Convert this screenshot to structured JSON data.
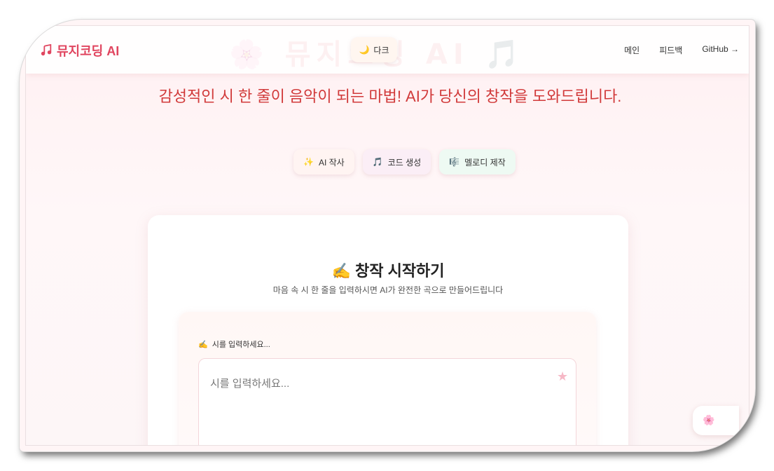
{
  "brand": {
    "name": "뮤지코딩 AI",
    "logo_icon": "music-notes-icon"
  },
  "theme_toggle": {
    "icon": "crescent-moon-icon",
    "label": "다크"
  },
  "nav": {
    "links": [
      "메인",
      "피드백",
      "GitHub →"
    ]
  },
  "hero": {
    "background_title": "🌸 뮤지코딩 AI 🎵",
    "headline": "감성적인 시 한 줄이 음악이 되는 마법! AI가 당신의 창작을 도와드립니다."
  },
  "features": [
    {
      "icon": "✨",
      "label": "AI 작사"
    },
    {
      "icon": "🎵",
      "label": "코드 생성"
    },
    {
      "icon": "🎼",
      "label": "멜로디 제작"
    }
  ],
  "card": {
    "title_icon": "✍️",
    "title": "창작 시작하기",
    "subtitle": "마음 속 시 한 줄을 입력하시면 AI가 완전한 곡으로 만들어드립니다"
  },
  "poem_input": {
    "label_icon": "✍️",
    "label": "시를 입력하세요...",
    "value": "",
    "placeholder": "시를 입력하세요...",
    "star_icon": "★"
  },
  "floating_button": {
    "icon": "🌸"
  },
  "colors": {
    "accent": "#e0455f",
    "headline": "#d13a3a",
    "background": "#fff0f2"
  }
}
